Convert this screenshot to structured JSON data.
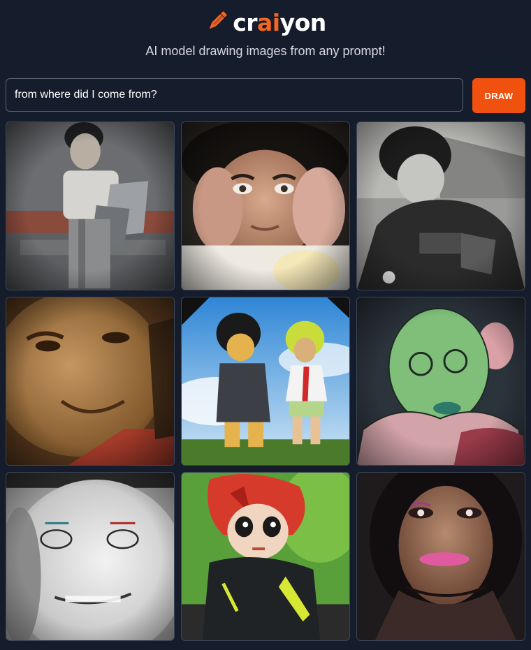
{
  "brand": {
    "logo_icon": "pencil-icon",
    "name_prefix": "cr",
    "name_ai": "ai",
    "name_suffix": "yon",
    "accent": "#f26522"
  },
  "tagline": "AI model drawing images from any prompt!",
  "prompt": {
    "value": "from where did I come from?",
    "placeholder": ""
  },
  "draw_button": {
    "label": "DRAW",
    "color": "#f0510f"
  },
  "results": {
    "grid": "3x3",
    "images": [
      "boy-with-bag-photo",
      "face-with-hands-photo",
      "bw-child-sweater-photo",
      "sepia-close-face",
      "anime-pair-sky",
      "green-face-drawing",
      "bw-smiling-face",
      "anime-red-hair-boy",
      "dark-portrait-girl"
    ]
  }
}
